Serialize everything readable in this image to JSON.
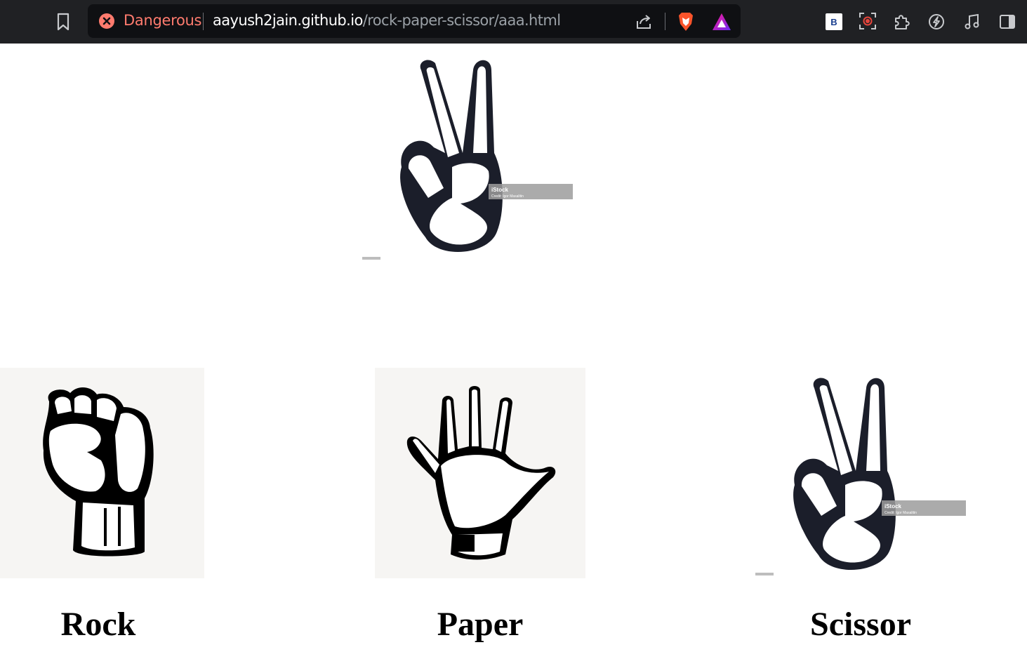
{
  "browser": {
    "security_label": "Dangerous",
    "url_host": "aayush2jain.github.io",
    "url_path": "/rock-paper-scissor/aaa.html",
    "extension_badge": "B",
    "danger_color": "#ff7b6e"
  },
  "computer_choice": {
    "icon": "scissor-hand-icon",
    "watermark_brand": "iStock",
    "watermark_credit": "Credit: Igor Masalitin"
  },
  "choices": [
    {
      "label": "Rock",
      "icon": "rock-fist-icon"
    },
    {
      "label": "Paper",
      "icon": "paper-hand-icon"
    },
    {
      "label": "Scissor",
      "icon": "scissor-hand-icon",
      "watermark_brand": "iStock",
      "watermark_credit": "Credit: Igor Masalitin"
    }
  ]
}
